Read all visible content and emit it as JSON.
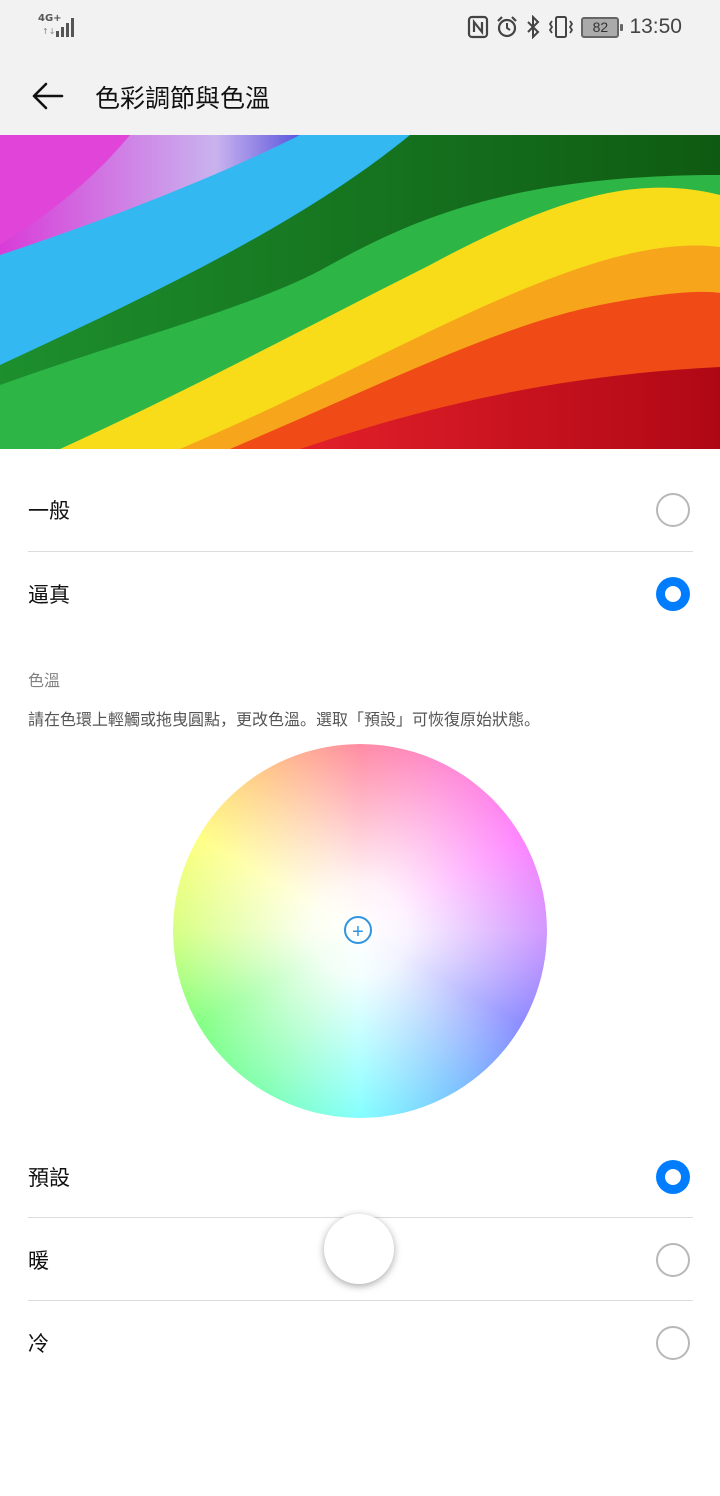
{
  "status_bar": {
    "network": "4G+",
    "signal_sub": "↑↓",
    "battery_level": "82",
    "time": "13:50",
    "icons": [
      "nfc-icon",
      "alarm-icon",
      "bluetooth-icon",
      "vibrate-icon",
      "battery-icon"
    ]
  },
  "header": {
    "back_icon": "back-arrow-icon",
    "title": "色彩調節與色溫"
  },
  "color_mode": {
    "options": [
      {
        "label": "一般",
        "selected": false
      },
      {
        "label": "逼真",
        "selected": true
      }
    ]
  },
  "color_temperature": {
    "section_label": "色溫",
    "hint": "請在色環上輕觸或拖曳圓點，更改色溫。選取「預設」可恢復原始狀態。",
    "wheel_marker_symbol": "+",
    "options": [
      {
        "label": "預設",
        "selected": true
      },
      {
        "label": "暖",
        "selected": false
      },
      {
        "label": "冷",
        "selected": false
      }
    ]
  },
  "colors": {
    "accent": "#007dff",
    "marker": "#2f95e0",
    "bar_background": "#f2f2f2",
    "divider": "#dcdcdc"
  }
}
